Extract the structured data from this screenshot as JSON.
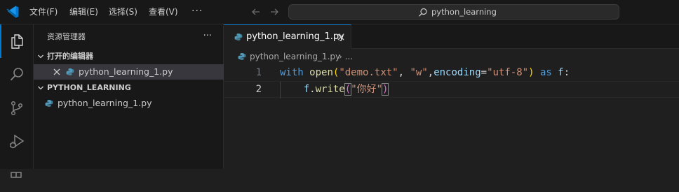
{
  "menu": {
    "file": "文件(F)",
    "edit": "编辑(E)",
    "selection": "选择(S)",
    "view": "查看(V)",
    "more": "···"
  },
  "command_center": {
    "text": "python_learning"
  },
  "sidebar": {
    "title": "资源管理器",
    "more": "···",
    "open_editors": {
      "label": "打开的编辑器",
      "items": [
        {
          "name": "python_learning_1.py"
        }
      ]
    },
    "folder": {
      "label": "PYTHON_LEARNING",
      "items": [
        {
          "name": "python_learning_1.py"
        }
      ]
    }
  },
  "editor": {
    "tab": {
      "label": "python_learning_1.py"
    },
    "breadcrumb": {
      "file": "python_learning_1.py",
      "sep": "› ..."
    },
    "lines": [
      {
        "number": "1",
        "tokens": [
          {
            "t": "with",
            "c": "k"
          },
          {
            "t": " ",
            "c": "p"
          },
          {
            "t": "open",
            "c": "f"
          },
          {
            "t": "(",
            "c": "b1"
          },
          {
            "t": "\"demo.txt\"",
            "c": "s"
          },
          {
            "t": ", ",
            "c": "p"
          },
          {
            "t": "\"w\"",
            "c": "s"
          },
          {
            "t": ",",
            "c": "p"
          },
          {
            "t": "encoding",
            "c": "v"
          },
          {
            "t": "=",
            "c": "p"
          },
          {
            "t": "\"utf-8\"",
            "c": "s"
          },
          {
            "t": ")",
            "c": "b1"
          },
          {
            "t": " ",
            "c": "p"
          },
          {
            "t": "as",
            "c": "k"
          },
          {
            "t": " ",
            "c": "p"
          },
          {
            "t": "f",
            "c": "v"
          },
          {
            "t": ":",
            "c": "p"
          }
        ]
      },
      {
        "number": "2",
        "tokens": [
          {
            "t": "    ",
            "c": "p"
          },
          {
            "t": "f",
            "c": "v"
          },
          {
            "t": ".",
            "c": "p"
          },
          {
            "t": "write",
            "c": "f"
          },
          {
            "t": "(",
            "c": "b2 bm"
          },
          {
            "t": "\"你好\"",
            "c": "s"
          },
          {
            "t": ")",
            "c": "b2 bm"
          }
        ]
      }
    ]
  },
  "colors": {
    "accent": "#0078d4",
    "python_blue": "#519aba",
    "keyword": "#569cd6",
    "function": "#dcdcaa",
    "string": "#ce9178",
    "variable": "#9cdcfe"
  },
  "icons": {
    "app": "vscode-logo-icon",
    "explorer": "files-icon",
    "search": "search-icon",
    "source_control": "source-control-icon",
    "run_debug": "run-debug-icon",
    "file": "python-file-icon"
  }
}
